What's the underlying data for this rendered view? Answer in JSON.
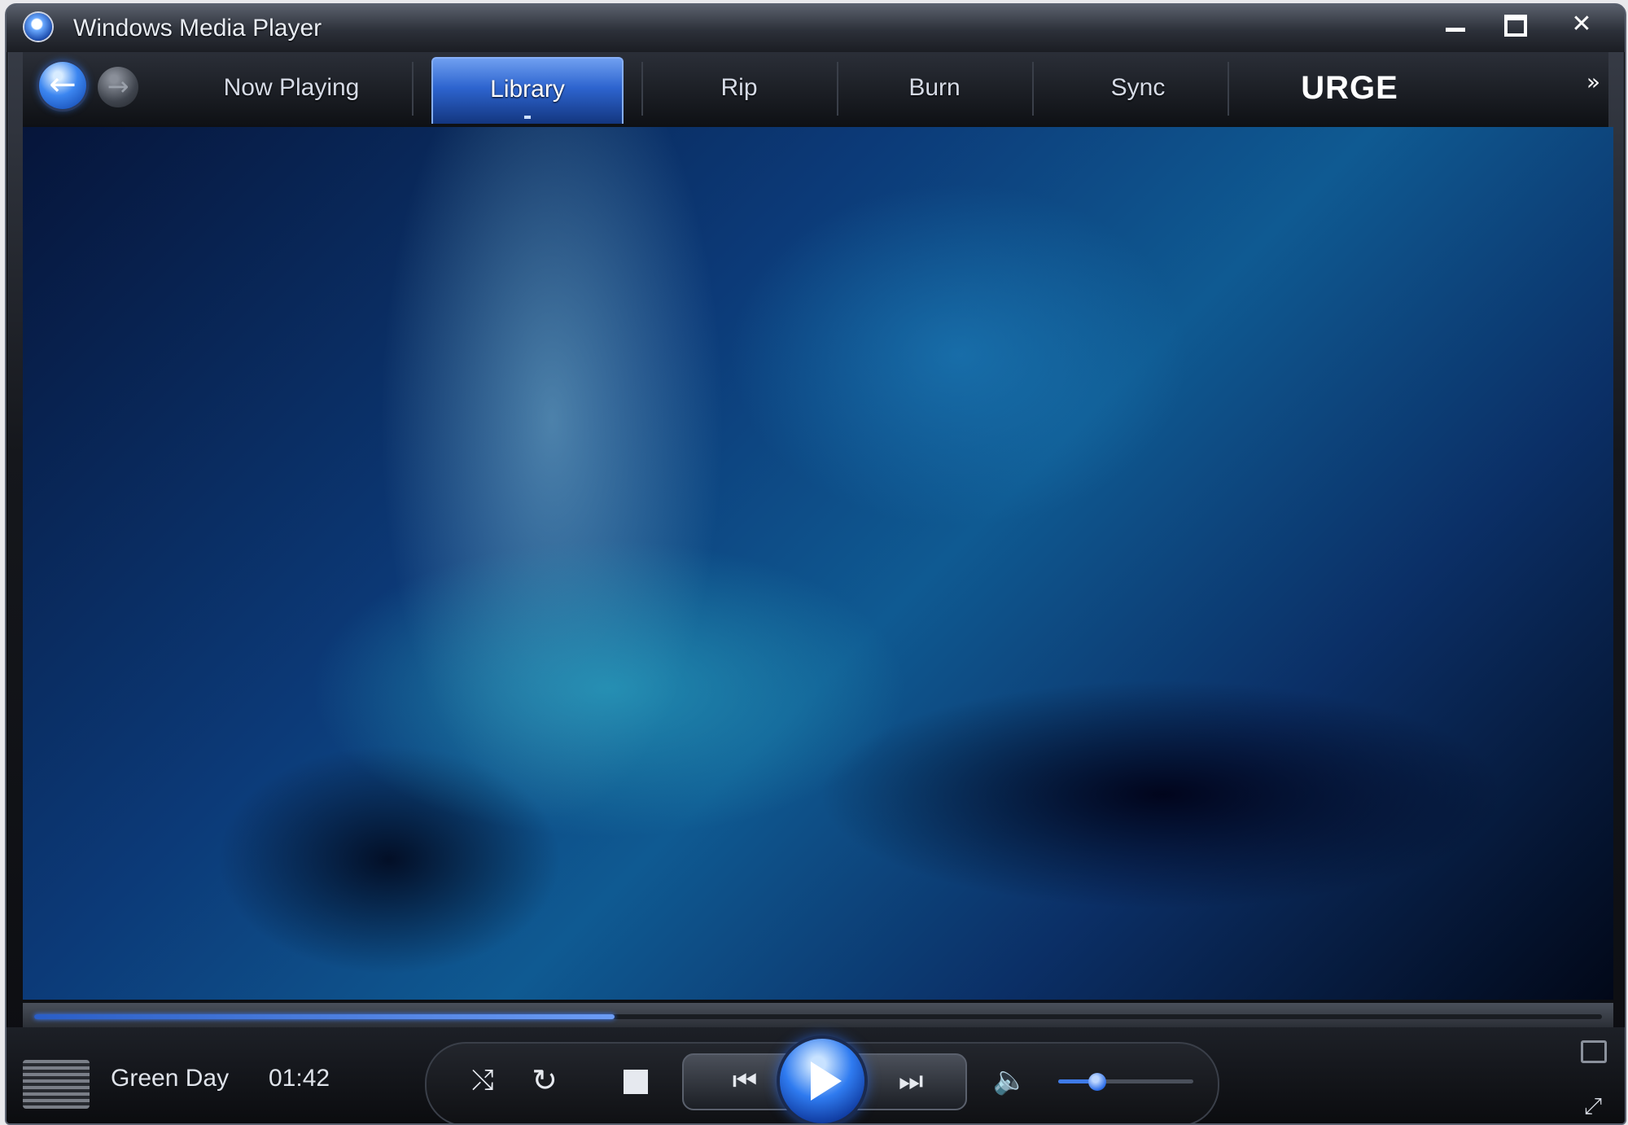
{
  "window": {
    "title": "Windows Media Player",
    "accent_color": "#2d64cf"
  },
  "nav": {
    "back_icon": "back-arrow-icon",
    "forward_icon": "forward-arrow-icon",
    "tabs": [
      {
        "label": "Now Playing",
        "active": false
      },
      {
        "label": "Library",
        "active": true
      },
      {
        "label": "Rip",
        "active": false
      },
      {
        "label": "Burn",
        "active": false
      },
      {
        "label": "Sync",
        "active": false
      },
      {
        "label": "URGE",
        "active": false
      }
    ],
    "more_glyph": "»"
  },
  "player": {
    "artist": "Green Day",
    "time": "01:42",
    "seek_progress": 0.37,
    "volume_level": 0.29
  },
  "controls": {
    "shuffle_glyph": "⤭",
    "repeat_glyph": "↻",
    "prev_glyph": "⏮",
    "next_glyph": "⏭",
    "mute_glyph": "🔈",
    "fullscreen_glyph": "⤢"
  }
}
